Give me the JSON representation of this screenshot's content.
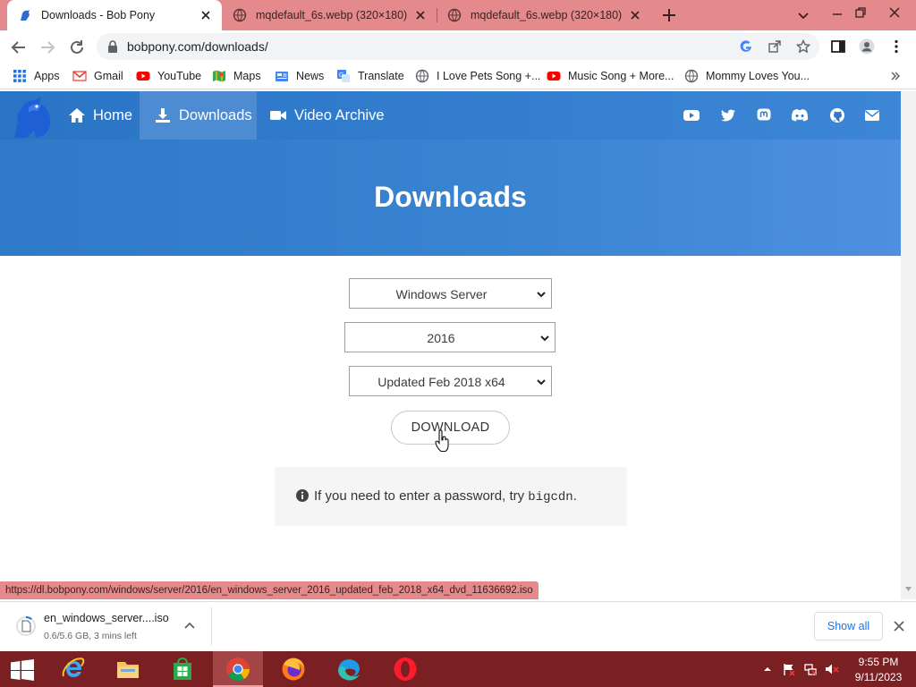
{
  "tabs": [
    {
      "title": "Downloads - Bob Pony",
      "active": true
    },
    {
      "title": "mqdefault_6s.webp (320×180)",
      "active": false
    },
    {
      "title": "mqdefault_6s.webp (320×180)",
      "active": false
    }
  ],
  "toolbar": {
    "url": "bobpony.com/downloads/"
  },
  "bookmarks": [
    {
      "label": "Apps",
      "icon": "apps-grid-icon"
    },
    {
      "label": "Gmail",
      "icon": "gmail-icon"
    },
    {
      "label": "YouTube",
      "icon": "youtube-icon"
    },
    {
      "label": "Maps",
      "icon": "maps-icon"
    },
    {
      "label": "News",
      "icon": "news-icon"
    },
    {
      "label": "Translate",
      "icon": "translate-icon"
    },
    {
      "label": "I Love Pets Song +...",
      "icon": "globe-icon"
    },
    {
      "label": "Music Song + More...",
      "icon": "youtube-icon"
    },
    {
      "label": "Mommy Loves You...",
      "icon": "globe-icon"
    }
  ],
  "site": {
    "nav": {
      "home": "Home",
      "downloads": "Downloads",
      "archive": "Video Archive"
    },
    "hero_title": "Downloads",
    "selects": {
      "product": "Windows Server",
      "version": "2016",
      "edition": "Updated Feb 2018 x64"
    },
    "download_label": "DOWNLOAD",
    "notice": {
      "text": "If you need to enter a password, try ",
      "code": "bigcdn",
      "end": "."
    }
  },
  "status_url": "https://dl.bobpony.com/windows/server/2016/en_windows_server_2016_updated_feb_2018_x64_dvd_11636692.iso",
  "download_shelf": {
    "file_name": "en_windows_server....iso",
    "progress": "0.6/5.6 GB, 3 mins left",
    "progress_fraction": 0.107,
    "show_all": "Show all"
  },
  "taskbar": {
    "time": "9:55 PM",
    "date": "9/11/2023"
  },
  "colors": {
    "tab_strip": "#e58a8c",
    "site_blue": "#2e79c8",
    "taskbar": "#7a1f22",
    "link_blue": "#1a73e8"
  }
}
